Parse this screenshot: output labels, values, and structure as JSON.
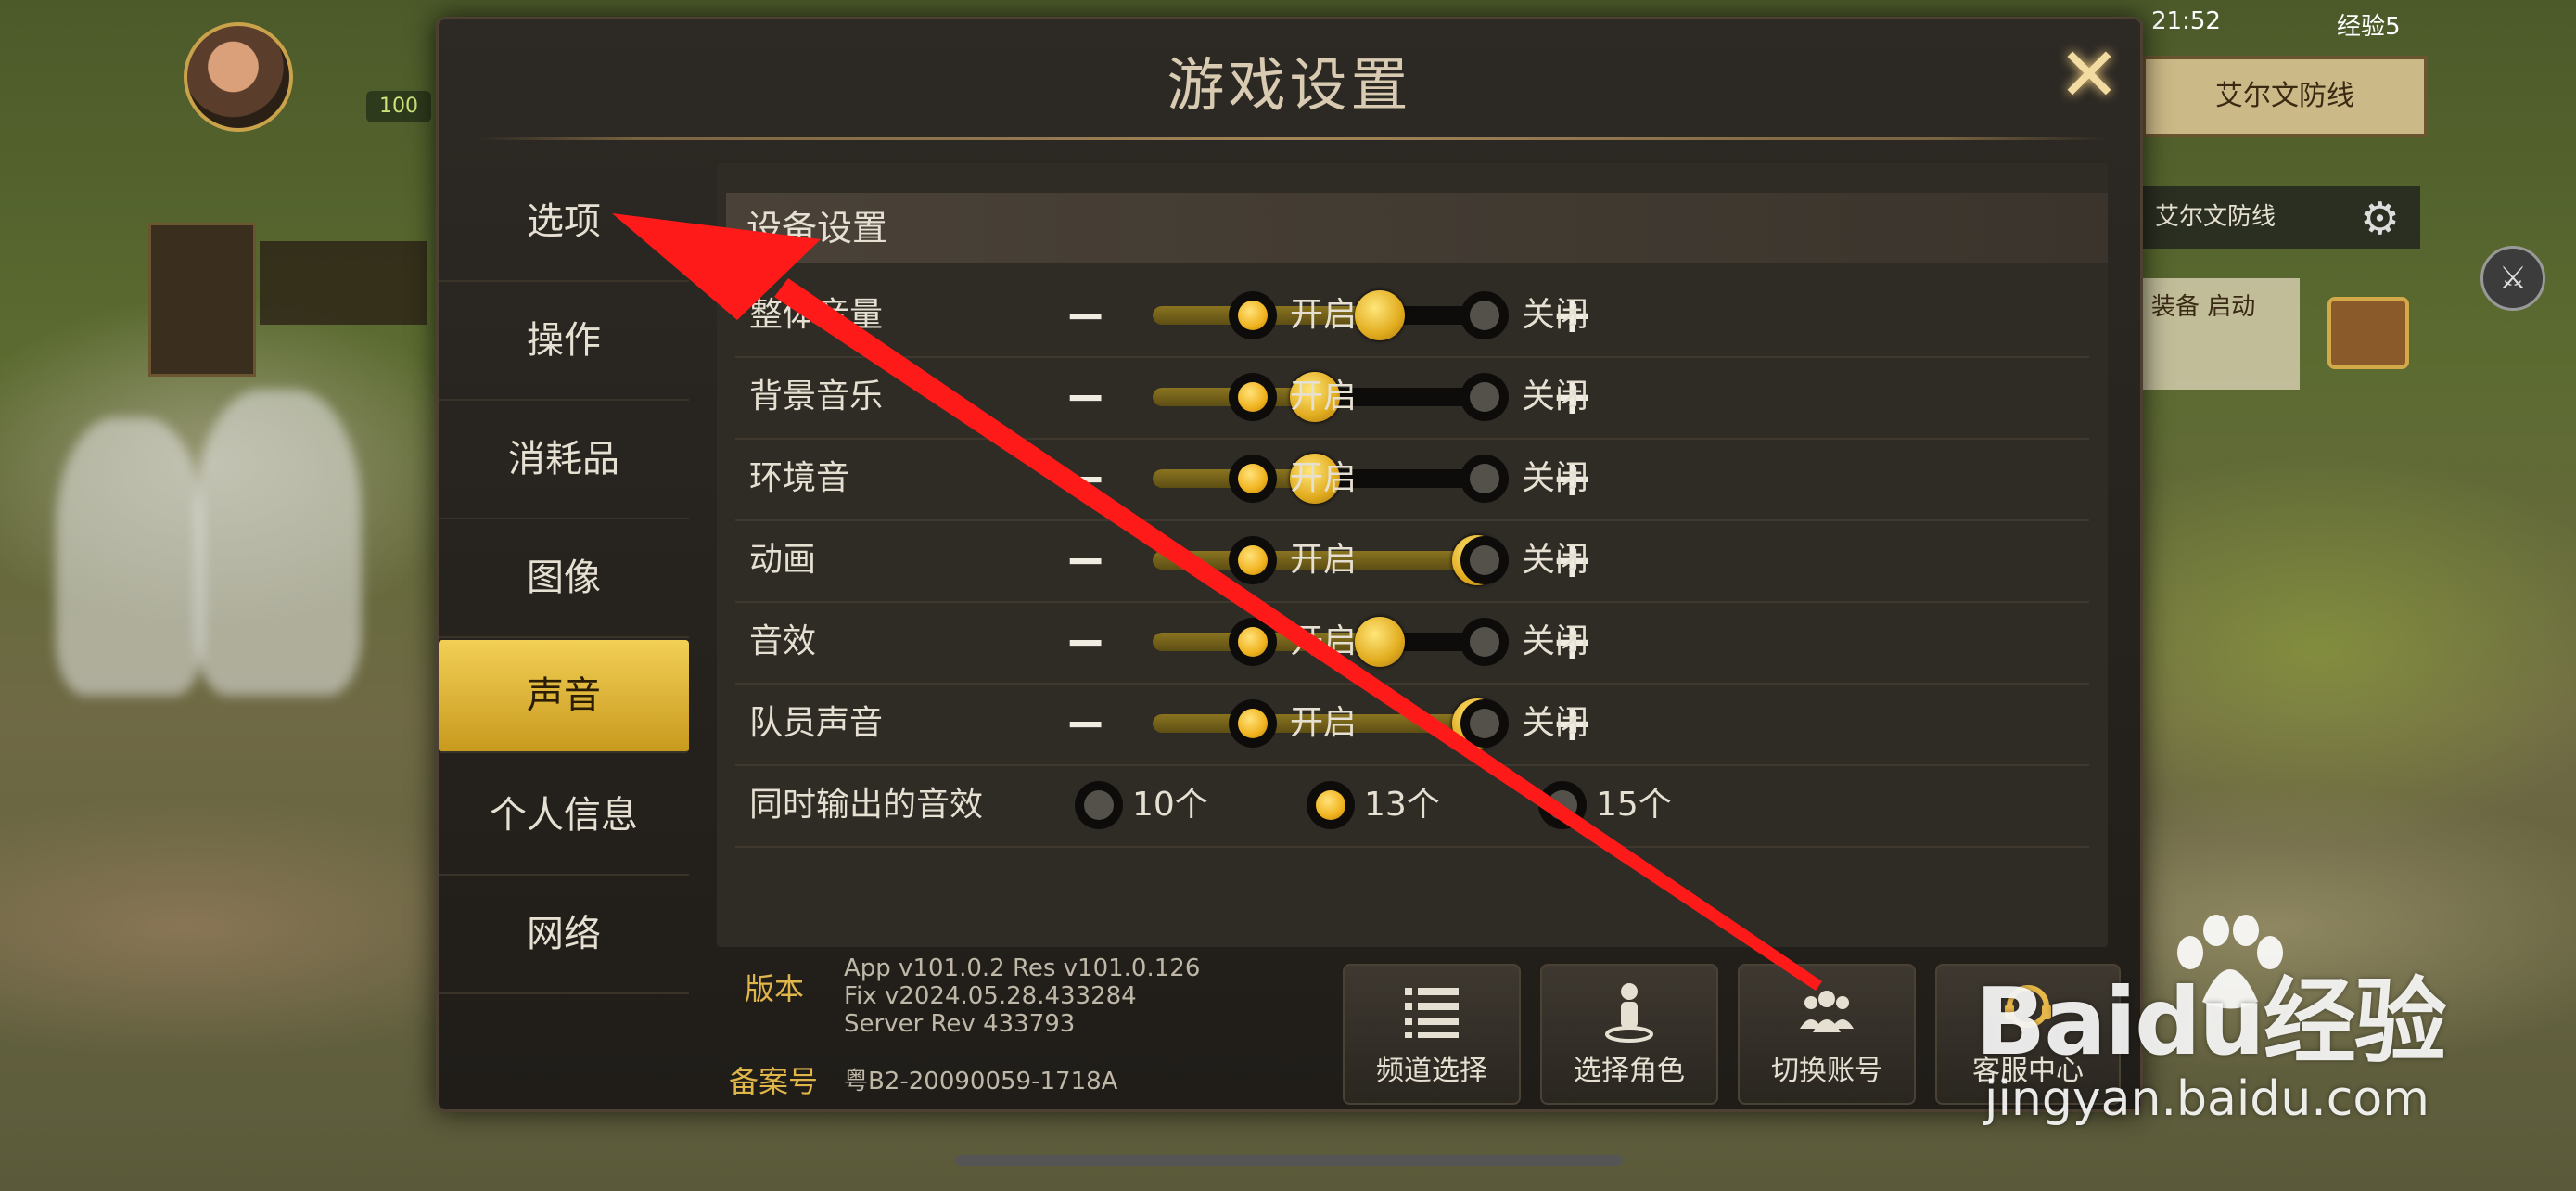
{
  "status_bar": {
    "time": "21:52",
    "carrier": "经验5"
  },
  "hud": {
    "level": "100",
    "minimap_title": "艾尔文防线",
    "minimap_row": "艾尔文防线",
    "side_text": "装备 启动"
  },
  "dialog": {
    "title": "游戏设置",
    "close_label": "✕"
  },
  "sidebar": {
    "items": [
      {
        "label": "选项",
        "active": false
      },
      {
        "label": "操作",
        "active": false
      },
      {
        "label": "消耗品",
        "active": false
      },
      {
        "label": "图像",
        "active": false
      },
      {
        "label": "声音",
        "active": true
      },
      {
        "label": "个人信息",
        "active": false
      },
      {
        "label": "网络",
        "active": false
      }
    ]
  },
  "content": {
    "section_title": "设备设置",
    "on_label": "开启",
    "off_label": "关闭",
    "sliders": [
      {
        "label": "整体音量",
        "value": 0.7,
        "enabled": true
      },
      {
        "label": "背景音乐",
        "value": 0.5,
        "enabled": true
      },
      {
        "label": "环境音",
        "value": 0.5,
        "enabled": true
      },
      {
        "label": "动画",
        "value": 1.0,
        "enabled": true
      },
      {
        "label": "音效",
        "value": 0.7,
        "enabled": true
      },
      {
        "label": "队员声音",
        "value": 1.0,
        "enabled": true
      }
    ],
    "simultaneous": {
      "label": "同时输出的音效",
      "options": [
        "10个",
        "13个",
        "15个"
      ],
      "selected": "13个"
    }
  },
  "footer": {
    "version_label": "版本",
    "version_lines": [
      "App v101.0.2 Res v101.0.126",
      "Fix v2024.05.28.433284",
      "Server Rev 433793"
    ],
    "beian_label": "备案号",
    "beian_value": "粤B2-20090059-1718A",
    "buttons": [
      {
        "label": "频道选择",
        "icon": "list-icon"
      },
      {
        "label": "选择角色",
        "icon": "character-icon"
      },
      {
        "label": "切换账号",
        "icon": "users-icon"
      },
      {
        "label": "客服中心",
        "icon": "support-icon"
      }
    ]
  },
  "watermark": {
    "logo": "Baidu经验",
    "url": "jingyan.baidu.com"
  },
  "colors": {
    "accent": "#f0b21e",
    "annotation": "#ff1a1a",
    "panel": "#2f2b25"
  }
}
